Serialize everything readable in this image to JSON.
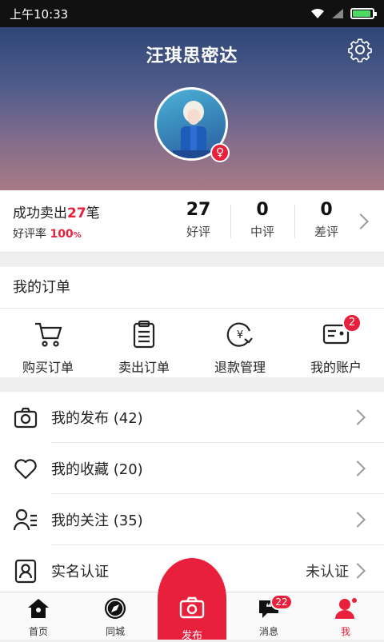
{
  "status": {
    "time": "上午10:33"
  },
  "header": {
    "username": "汪琪思密达"
  },
  "stats": {
    "sold_prefix": "成功卖出",
    "sold_count": "27",
    "sold_suffix": "笔",
    "rate_label": "好评率",
    "rate_value": "100",
    "rate_unit": "%",
    "good": {
      "count": "27",
      "label": "好评"
    },
    "neutral": {
      "count": "0",
      "label": "中评"
    },
    "bad": {
      "count": "0",
      "label": "差评"
    }
  },
  "orders": {
    "title": "我的订单",
    "items": [
      {
        "label": "购买订单",
        "icon": "cart-icon"
      },
      {
        "label": "卖出订单",
        "icon": "clipboard-icon"
      },
      {
        "label": "退款管理",
        "icon": "refund-icon"
      },
      {
        "label": "我的账户",
        "icon": "wallet-icon",
        "badge": "2"
      }
    ]
  },
  "menu": [
    {
      "label": "我的发布 (42)",
      "icon": "camera-icon"
    },
    {
      "label": "我的收藏 (20)",
      "icon": "heart-icon"
    },
    {
      "label": "我的关注 (35)",
      "icon": "follow-icon"
    },
    {
      "label": "实名认证",
      "icon": "id-card-icon",
      "value": "未认证"
    }
  ],
  "tabs": {
    "home": "首页",
    "city": "同城",
    "publish": "发布",
    "messages": "消息",
    "messages_badge": "22",
    "me": "我"
  },
  "colors": {
    "accent": "#e8203c"
  }
}
